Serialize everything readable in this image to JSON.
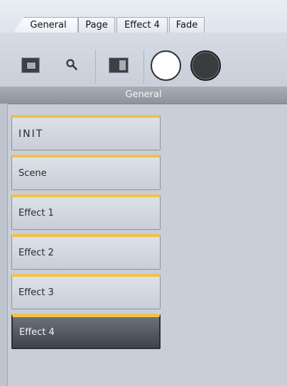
{
  "tabs": [
    {
      "label": "General",
      "active": true
    },
    {
      "label": "Page",
      "active": false
    },
    {
      "label": "Effect 4",
      "active": false
    },
    {
      "label": "Fade",
      "active": false
    }
  ],
  "toolbar": {
    "tools": [
      "frame-icon",
      "search-icon",
      "split-layout-icon",
      "white-circle-icon",
      "black-circle-icon"
    ]
  },
  "section": {
    "title": "General"
  },
  "list": {
    "items": [
      {
        "label": "INIT",
        "selected": false
      },
      {
        "label": "Scene",
        "selected": false
      },
      {
        "label": "Effect 1",
        "selected": false
      },
      {
        "label": "Effect 2",
        "selected": false
      },
      {
        "label": "Effect 3",
        "selected": false
      },
      {
        "label": "Effect 4",
        "selected": true
      }
    ]
  },
  "colors": {
    "accent": "#f0c24a",
    "selected_bg": "#4a4e55",
    "header_bg": "#9a9ea6"
  }
}
